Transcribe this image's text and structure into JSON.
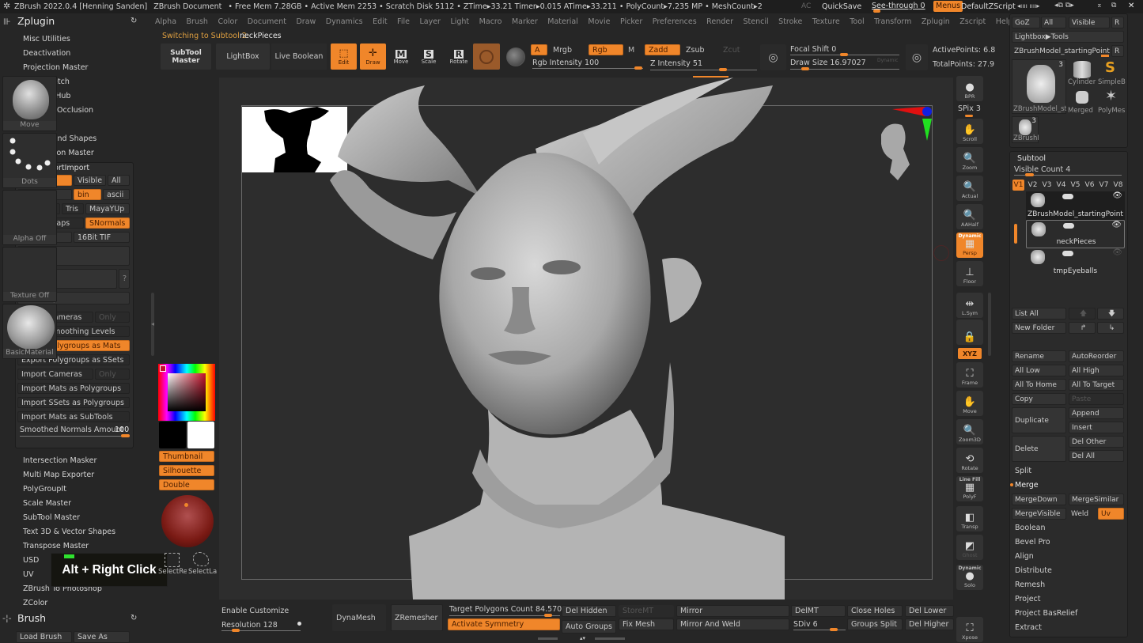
{
  "titlebar": {
    "app": "ZBrush 2022.0.4 [Henning Sanden]",
    "doc": "ZBrush Document",
    "stats": "• Free Mem 7.28GB • Active Mem 2253 • Scratch Disk 5112 •  ZTime▸33.21 Timer▸0.015 ATime▸33.211 • PolyCount▸7.235 MP  • MeshCount▸2",
    "ac": "AC",
    "quicksave": "QuickSave",
    "seethrough": "See-through  0",
    "seethrough_value": 0,
    "menus": "Menus",
    "zscript": "DefaultZScript",
    "icons": [
      "◂ıııı ıııı▸",
      "◂⧉ ⧉▸",
      "⌅",
      "⧉",
      "✕"
    ]
  },
  "menubar": [
    "Alpha",
    "Brush",
    "Color",
    "Document",
    "Draw",
    "Dynamics",
    "Edit",
    "File",
    "Layer",
    "Light",
    "Macro",
    "Marker",
    "Material",
    "Movie",
    "Picker",
    "Preferences",
    "Render",
    "Stencil",
    "Stroke",
    "Texture",
    "Tool",
    "Transform",
    "Zplugin",
    "Zscript",
    "Help"
  ],
  "left": {
    "title": "Zplugin",
    "plugins_top": [
      "Misc Utilities",
      "Deactivation",
      "Projection Master",
      "QuickSketch",
      "3D Print Hub",
      "Ambient Occlusion",
      "BevelPro",
      "Maya Blend Shapes",
      "Decimation Master"
    ],
    "fbx": {
      "title": "FBX ExportImport",
      "selected": "Selected",
      "visible": "Visible",
      "all": "All",
      "version": "FBX 2020",
      "bin": "bin",
      "ascii": "ascii",
      "layers": "Layers",
      "tris": "Tris",
      "mayayup": "MayaYUp",
      "embed": "Embed Maps",
      "snormals": "SNormals",
      "tga": "TGA",
      "tif": "16Bit TIF",
      "export": "Export",
      "import": "Import",
      "help": "?",
      "options": "Options |",
      "export_cameras": "Export Cameras",
      "only1": "Only",
      "export_smoothing": "Export Smoothing Levels",
      "export_pg_mats": "Export Polygroups as Mats",
      "export_pg_ssets": "Export Polygroups as SSets",
      "import_cameras": "Import Cameras",
      "only2": "Only",
      "import_mats_pg": "Import Mats as Polygroups",
      "import_ssets_pg": "Import SSets as Polygroups",
      "import_mats_st": "Import Mats as SubTools",
      "smoothed_label": "Smoothed Normals Amount",
      "smoothed_value": "100"
    },
    "plugins_bottom": [
      "Intersection Masker",
      "Multi Map Exporter",
      "PolyGroupIt",
      "Scale Master",
      "SubTool Master",
      "Text 3D & Vector Shapes",
      "Transpose Master",
      "USD",
      "UV",
      "ZBrush To Photoshop",
      "ZColor"
    ],
    "brush_title": "Brush",
    "load_brush": "Load Brush",
    "save_as": "Save As"
  },
  "tooltip": "Alt + Right Click",
  "status_msg": {
    "prefix": "Switching to Subtool 2:",
    "name": "neckPieces"
  },
  "shelf": {
    "subtool_master": "SubTool\nMaster",
    "lightbox": "LightBox",
    "live_boolean": "Live Boolean",
    "edit": "Edit",
    "draw": "Draw",
    "move": "Move",
    "scale": "Scale",
    "rotate": "Rotate",
    "a": "A",
    "mrgb": "Mrgb",
    "rgb": "Rgb",
    "m": "M",
    "zadd": "Zadd",
    "zsub": "Zsub",
    "zcut": "Zcut",
    "rgb_intensity": "Rgb Intensity 100",
    "rgb_intensity_value": 100,
    "z_intensity": "Z Intensity 51",
    "z_intensity_value": 51,
    "focal_shift": "Focal Shift 0",
    "focal_value": 0,
    "draw_size": "Draw Size 16.97027",
    "dynamic": "Dynamic",
    "active_points": "ActivePoints: 6.8",
    "total_points": "TotalPoints: 27.9"
  },
  "tools": {
    "brush": "Move",
    "stroke": "Dots",
    "alpha": "Alpha Off",
    "texture": "Texture Off",
    "material": "BasicMaterial",
    "thumbnail": "Thumbnail",
    "silhouette": "Silhouette",
    "double": "Double",
    "select_rect": "SelectRe",
    "select_lasso": "SelectLa"
  },
  "right_toolbar": [
    {
      "id": "bpr",
      "label": "BPR"
    },
    {
      "id": "spix",
      "label": "SPix 3"
    },
    {
      "id": "scroll",
      "label": "Scroll"
    },
    {
      "id": "zoom",
      "label": "Zoom"
    },
    {
      "id": "actual",
      "label": "Actual"
    },
    {
      "id": "aahalf",
      "label": "AAHalf"
    },
    {
      "id": "persp",
      "label": "Persp",
      "top": "Dynamic"
    },
    {
      "id": "floor",
      "label": "Floor"
    },
    {
      "id": "lsym",
      "label": "L.Sym"
    },
    {
      "id": "lock",
      "label": ""
    },
    {
      "id": "xyz",
      "label": "XYZ"
    },
    {
      "id": "frame",
      "label": "Frame"
    },
    {
      "id": "move",
      "label": "Move"
    },
    {
      "id": "zoom3d",
      "label": "Zoom3D"
    },
    {
      "id": "rotate",
      "label": "Rotate"
    },
    {
      "id": "polyf",
      "label": "PolyF",
      "top": "Line Fill"
    },
    {
      "id": "transp",
      "label": "Transp"
    },
    {
      "id": "ghost",
      "label": "Ghost"
    },
    {
      "id": "solo",
      "label": "Solo",
      "top": "Dynamic"
    },
    {
      "id": "xpose",
      "label": "Xpose"
    }
  ],
  "right": {
    "goz": "GoZ",
    "all": "All",
    "visible": "Visible",
    "r": "R",
    "lightbox_tools": "Lightbox▶Tools",
    "current_tool": "ZBrushModel_startingPoint.",
    "tool_thumbs": [
      {
        "name": "ZBrushModel_st",
        "count": "3"
      },
      {
        "name": "Cylinder"
      },
      {
        "name": "SimpleB"
      },
      {
        "name": "Merged"
      },
      {
        "name": "PolyMes"
      },
      {
        "name": "ZBrushM",
        "count": "3"
      }
    ],
    "subtool_title": "Subtool",
    "visible_count": "Visible Count 4",
    "versions": [
      "V1",
      "V2",
      "V3",
      "V4",
      "V5",
      "V6",
      "V7",
      "V8"
    ],
    "subtools": [
      {
        "name": "ZBrushModel_startingPoint",
        "selected": false
      },
      {
        "name": "neckPieces",
        "selected": true
      },
      {
        "name": "tmpEyeballs",
        "selected": false
      }
    ],
    "list_all": "List All",
    "new_folder": "New Folder",
    "rename": "Rename",
    "autoreorder": "AutoReorder",
    "all_low": "All Low",
    "all_high": "All High",
    "all_to_home": "All To Home",
    "all_to_target": "All To Target",
    "copy": "Copy",
    "paste": "Paste",
    "duplicate": "Duplicate",
    "append": "Append",
    "insert": "Insert",
    "delete": "Delete",
    "del_other": "Del Other",
    "del_all": "Del All",
    "split": "Split",
    "merge": "Merge",
    "merge_down": "MergeDown",
    "merge_similar": "MergeSimilar",
    "merge_visible": "MergeVisible",
    "weld": "Weld",
    "uv": "Uv",
    "sections": [
      "Boolean",
      "Bevel Pro",
      "Align",
      "Distribute",
      "Remesh",
      "Project",
      "Project BasRelief",
      "Extract"
    ]
  },
  "bottom": {
    "enable_customize": "Enable Customize",
    "resolution": "Resolution 128",
    "resolution_value": 128,
    "dynamesh": "DynaMesh",
    "zremesher": "ZRemesher",
    "target_polygons": "Target Polygons Count 84.57086",
    "activate_symmetry": "Activate Symmetry",
    "del_hidden": "Del Hidden",
    "auto_groups": "Auto Groups",
    "store_mt": "StoreMT",
    "fix_mesh": "Fix Mesh",
    "mirror": "Mirror",
    "mirror_weld": "Mirror And Weld",
    "del_mt": "DelMT",
    "sdiv": "SDiv 6",
    "sdiv_value": 6,
    "close_holes": "Close Holes",
    "groups_split": "Groups Split",
    "del_lower": "Del Lower",
    "del_higher": "Del Higher"
  },
  "colors": {
    "accent": "#f0862a",
    "panel": "#262626",
    "canvas": "#2d2d2d",
    "model": "#b8b8b8"
  }
}
